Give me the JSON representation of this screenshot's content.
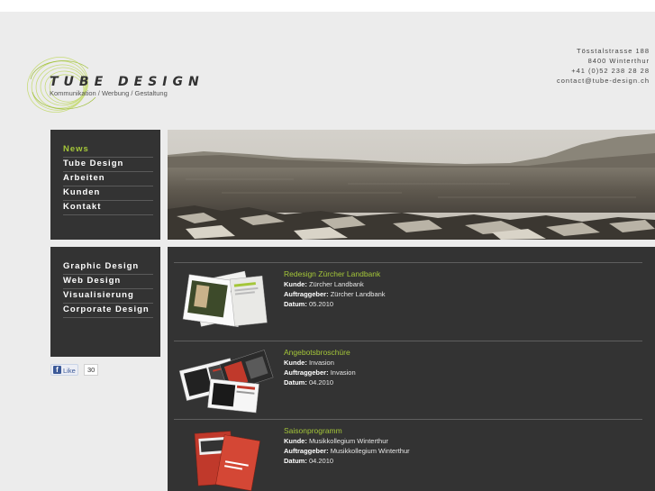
{
  "brand": {
    "title": "TUBE DESIGN",
    "tagline": "Kommunikation / Werbung / Gestaltung"
  },
  "contact": {
    "street": "Tösstalstrasse 188",
    "city": "8400 Winterthur",
    "phone": "+41 (0)52 238 28 28",
    "email": "contact@tube-design.ch"
  },
  "nav_main": [
    {
      "label": "News"
    },
    {
      "label": "Tube Design"
    },
    {
      "label": "Arbeiten"
    },
    {
      "label": "Kunden"
    },
    {
      "label": "Kontakt"
    }
  ],
  "nav_services": [
    {
      "label": "Graphic Design"
    },
    {
      "label": "Web Design"
    },
    {
      "label": "Visualisierung"
    },
    {
      "label": "Corporate Design"
    }
  ],
  "like": {
    "label": "Like",
    "count": "30",
    "icon": "facebook-icon"
  },
  "field_labels": {
    "client": "Kunde:",
    "commissioner": "Auftraggeber:",
    "date": "Datum:"
  },
  "projects": [
    {
      "title": "Redesign Zürcher Landbank",
      "client": "Zürcher Landbank",
      "commissioner": "Zürcher Landbank",
      "date": "05.2010"
    },
    {
      "title": "Angebotsbroschüre",
      "client": "Invasion",
      "commissioner": "Invasion",
      "date": "04.2010"
    },
    {
      "title": "Saisonprogramm",
      "client": "Musikkollegium Winterthur",
      "commissioner": "Musikkollegium Winterthur",
      "date": "04.2010"
    }
  ],
  "colors": {
    "accent": "#a4c639",
    "panel": "#333333",
    "background": "#ececec"
  }
}
